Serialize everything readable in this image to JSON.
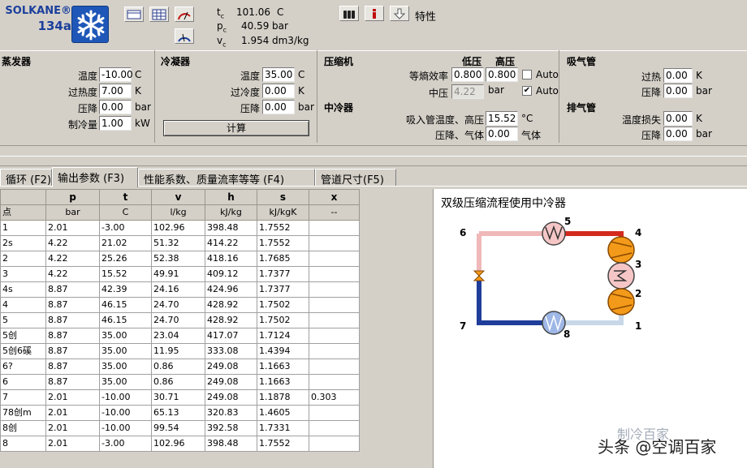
{
  "logo": {
    "line1": "SOLKANE®",
    "line2": "134a",
    "icon": "snowflake-icon"
  },
  "toolbar": {
    "icons": [
      "table-view-icon",
      "grid-view-icon",
      "gauge-icon",
      "gauge2-icon"
    ]
  },
  "props": [
    {
      "sym": "t",
      "sub": "c",
      "value": "101.06",
      "unit": "C"
    },
    {
      "sym": "p",
      "sub": "c",
      "value": "40.59",
      "unit": "bar"
    },
    {
      "sym": "v",
      "sub": "c",
      "value": "1.954",
      "unit": "dm3/kg"
    }
  ],
  "right_toolbar": {
    "icons": [
      "cylinders-icon",
      "info-icon",
      "down-arrow-icon"
    ],
    "label": "特性"
  },
  "evaporator": {
    "title": "蒸发器",
    "fields": [
      {
        "label": "温度",
        "value": "-10.00",
        "unit": "C"
      },
      {
        "label": "过热度",
        "value": "7.00",
        "unit": "K"
      },
      {
        "label": "压降",
        "value": "0.00",
        "unit": "bar"
      },
      {
        "label": "制冷量",
        "value": "1.00",
        "unit": "kW"
      }
    ]
  },
  "condenser": {
    "title": "冷凝器",
    "fields": [
      {
        "label": "温度",
        "value": "35.00",
        "unit": "C"
      },
      {
        "label": "过冷度",
        "value": "0.00",
        "unit": "K"
      },
      {
        "label": "压降",
        "value": "0.00",
        "unit": "bar"
      }
    ],
    "calc_label": "计算"
  },
  "compressor": {
    "title": "压缩机",
    "low_label": "低压",
    "high_label": "高压",
    "eff_label": "等熵效率",
    "eff_low": "0.800",
    "eff_high": "0.800",
    "auto1_label": "Auto",
    "auto1_checked": false,
    "mid_label": "中压",
    "mid_value": "4.22",
    "mid_unit": "bar",
    "auto2_label": "Auto",
    "auto2_checked": true
  },
  "intercooler": {
    "title": "中冷器",
    "temp_label": "吸入管温度、高压",
    "temp_value": "15.52",
    "temp_unit": "°C",
    "drop_label": "压降、气体",
    "drop_value": "0.00",
    "drop_unit": "气体"
  },
  "suction_line": {
    "title": "吸气管",
    "fields": [
      {
        "label": "过热",
        "value": "0.00",
        "unit": "K"
      },
      {
        "label": "压降",
        "value": "0.00",
        "unit": "bar"
      }
    ]
  },
  "discharge_line": {
    "title": "排气管",
    "fields": [
      {
        "label": "温度损失",
        "value": "0.00",
        "unit": "K"
      },
      {
        "label": "压降",
        "value": "0.00",
        "unit": "bar"
      }
    ]
  },
  "tabs": [
    {
      "label": "循环 (F2)",
      "active": false
    },
    {
      "label": "输出参数 (F3)",
      "active": true
    },
    {
      "label": "性能系数、质量流率等等 (F4)",
      "active": false
    },
    {
      "label": "管道尺寸(F5)",
      "active": false
    }
  ],
  "table": {
    "headers": [
      "",
      "p",
      "t",
      "v",
      "h",
      "s",
      "x"
    ],
    "units": [
      "点",
      "bar",
      "C",
      "l/kg",
      "kJ/kg",
      "kJ/kgK",
      "--"
    ],
    "rows": [
      [
        "1",
        "2.01",
        "-3.00",
        "102.96",
        "398.48",
        "1.7552",
        ""
      ],
      [
        "2s",
        "4.22",
        "21.02",
        "51.32",
        "414.22",
        "1.7552",
        ""
      ],
      [
        "2",
        "4.22",
        "25.26",
        "52.38",
        "418.16",
        "1.7685",
        ""
      ],
      [
        "3",
        "4.22",
        "15.52",
        "49.91",
        "409.12",
        "1.7377",
        ""
      ],
      [
        "4s",
        "8.87",
        "42.39",
        "24.16",
        "424.96",
        "1.7377",
        ""
      ],
      [
        "4",
        "8.87",
        "46.15",
        "24.70",
        "428.92",
        "1.7502",
        ""
      ],
      [
        "5",
        "8.87",
        "46.15",
        "24.70",
        "428.92",
        "1.7502",
        ""
      ],
      [
        "5创",
        "8.87",
        "35.00",
        "23.04",
        "417.07",
        "1.7124",
        ""
      ],
      [
        "5创6磎",
        "8.87",
        "35.00",
        "11.95",
        "333.08",
        "1.4394",
        ""
      ],
      [
        "6?",
        "8.87",
        "35.00",
        "0.86",
        "249.08",
        "1.1663",
        ""
      ],
      [
        "6",
        "8.87",
        "35.00",
        "0.86",
        "249.08",
        "1.1663",
        ""
      ],
      [
        "7",
        "2.01",
        "-10.00",
        "30.71",
        "249.08",
        "1.1878",
        "0.303"
      ],
      [
        "78创m",
        "2.01",
        "-10.00",
        "65.13",
        "320.83",
        "1.4605",
        ""
      ],
      [
        "8创",
        "2.01",
        "-10.00",
        "99.54",
        "392.58",
        "1.7331",
        ""
      ],
      [
        "8",
        "2.01",
        "-3.00",
        "102.96",
        "398.48",
        "1.7552",
        ""
      ]
    ]
  },
  "diagram": {
    "title": "双级压缩流程使用中冷器",
    "points": [
      "1",
      "2",
      "3",
      "4",
      "5",
      "6",
      "7",
      "8"
    ],
    "colors": {
      "hot": "#d42a1e",
      "cold": "#1f3d9a",
      "pink": "#f0b8b8",
      "light": "#c8d8e8",
      "compressor": "#f39a1a"
    }
  },
  "watermark": {
    "line1": "制冷百家",
    "line2": "头条 @空调百家"
  }
}
